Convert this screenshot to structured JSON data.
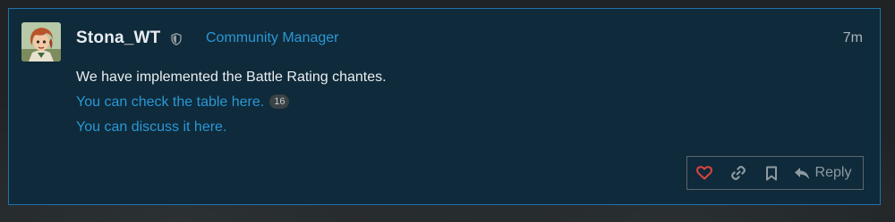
{
  "post": {
    "username": "Stona_WT",
    "user_title": "Community Manager",
    "date": "7m",
    "body_line1": "We have implemented the Battle Rating chantes.",
    "link1_text": "You can check the table here.",
    "link1_clicks": "16",
    "link2_text": "You can discuss it here."
  },
  "actions": {
    "reply_label": "Reply"
  },
  "colors": {
    "post_bg": "#0f2a3a",
    "post_border": "#1f74a8",
    "link": "#2a98d6",
    "like": "#e0443e",
    "muted": "#8e9aa0"
  },
  "icons": [
    "avatar",
    "moderator-shield-icon",
    "heart-icon",
    "link-icon",
    "bookmark-icon",
    "reply-icon"
  ]
}
